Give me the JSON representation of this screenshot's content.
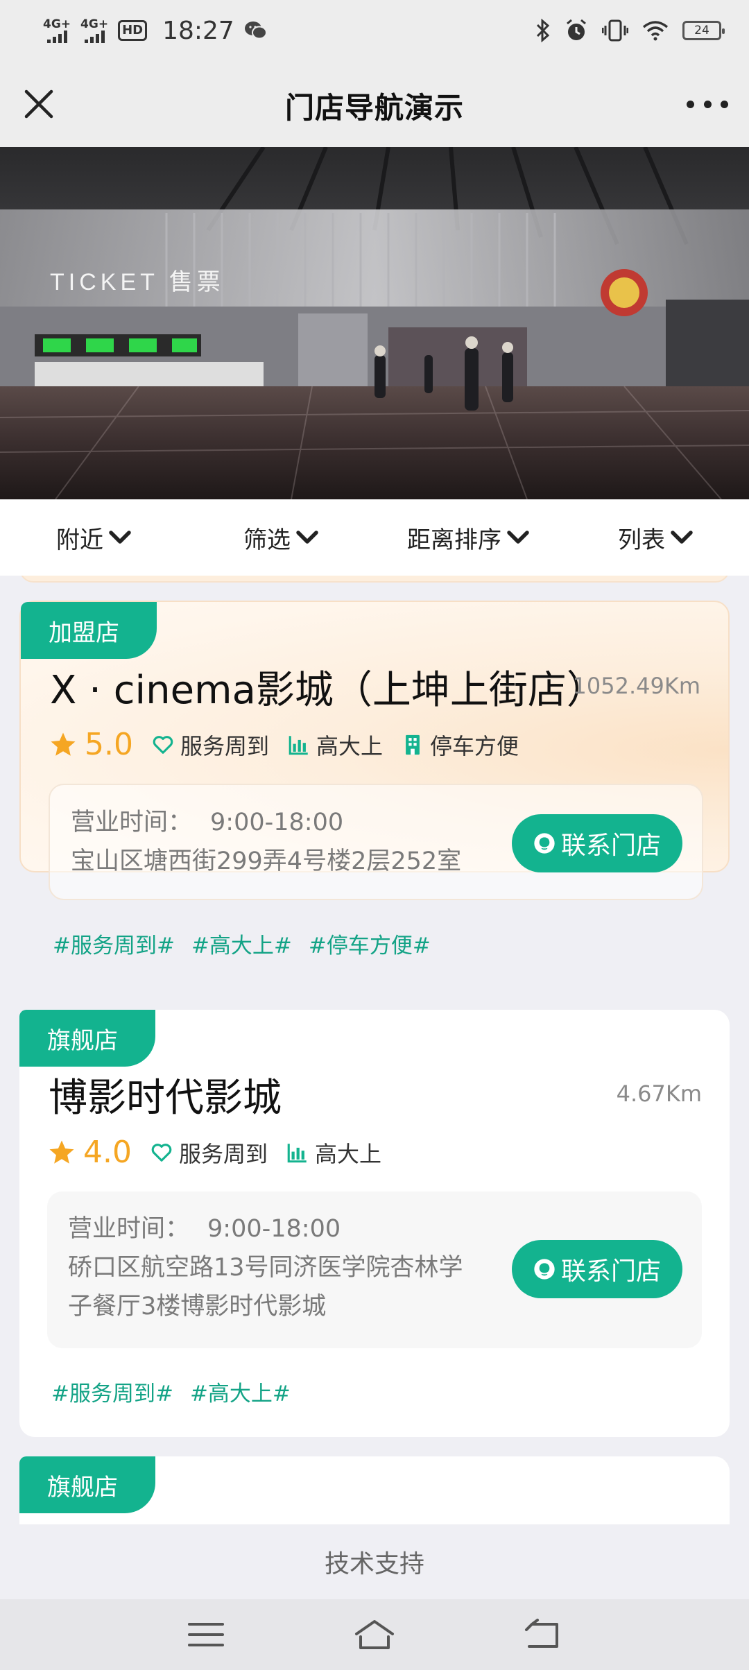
{
  "status_bar": {
    "signal1": "4G+",
    "signal2": "4G+",
    "hd": "HD",
    "time": "18:27",
    "battery": "24"
  },
  "nav": {
    "title": "门店导航演示"
  },
  "banner": {
    "sign_text": "TICKET 售票"
  },
  "filters": [
    {
      "label": "附近"
    },
    {
      "label": "筛选"
    },
    {
      "label": "距离排序"
    },
    {
      "label": "列表"
    }
  ],
  "stores": [
    {
      "badge": "加盟店",
      "name": "X · cinema影城（上坤上街店）",
      "distance": "1052.49Km",
      "rating": "5.0",
      "features": [
        "服务周到",
        "高大上",
        "停车方便"
      ],
      "hours_label": "营业时间：",
      "hours": "9:00-18:00",
      "address": "宝山区塘西街299弄4号楼2层252室",
      "contact": "联系门店",
      "hashtags": [
        "#服务周到#",
        "#高大上#",
        "#停车方便#"
      ]
    },
    {
      "badge": "旗舰店",
      "name": "博影时代影城",
      "distance": "4.67Km",
      "rating": "4.0",
      "features": [
        "服务周到",
        "高大上"
      ],
      "hours_label": "营业时间：",
      "hours": "9:00-18:00",
      "address": "硚口区航空路13号同济医学院杏林学子餐厅3楼博影时代影城",
      "contact": "联系门店",
      "hashtags": [
        "#服务周到#",
        "#高大上#"
      ]
    },
    {
      "badge": "旗舰店"
    }
  ],
  "footer": {
    "support": "技术支持"
  },
  "colors": {
    "accent": "#13b38f",
    "star": "#f5a623"
  }
}
